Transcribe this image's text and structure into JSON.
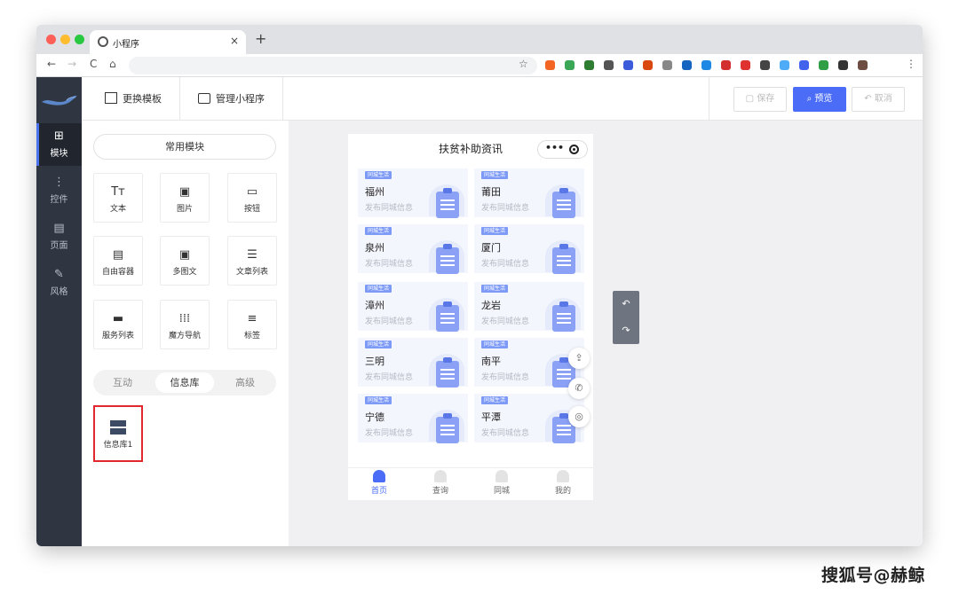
{
  "browser": {
    "tab_title": "小程序",
    "tab_close": "×",
    "new_tab": "+",
    "nav": {
      "back": "←",
      "forward": "→",
      "reload": "C",
      "home": "⌂"
    },
    "star": "☆",
    "menu": "⋮",
    "extensions": [
      "#f26522",
      "#3aa757",
      "#2e7d32",
      "#555555",
      "#3b5bdb",
      "#d9480f",
      "#888888",
      "#1565c0",
      "#1e88e5",
      "#d32f2f",
      "#e03131",
      "#444444",
      "#4dabf7",
      "#4263eb",
      "#2f9e44",
      "#333333",
      "#6d4c41"
    ]
  },
  "leftnav": {
    "items": [
      {
        "label": "模块",
        "icon": "plus-square-icon",
        "glyph": "⊞"
      },
      {
        "label": "控件",
        "icon": "controls-icon",
        "glyph": "⋮"
      },
      {
        "label": "页面",
        "icon": "page-icon",
        "glyph": "▤"
      },
      {
        "label": "风格",
        "icon": "magic-wand-icon",
        "glyph": "✎"
      }
    ]
  },
  "topbar": {
    "change_template": "更换模板",
    "manage_miniprogram": "管理小程序",
    "save": "保存",
    "preview": "预览",
    "cancel": "取消"
  },
  "panel": {
    "common_modules": "常用模块",
    "tiles": [
      {
        "label": "文本",
        "glyph": "Tт",
        "icon": "text-icon"
      },
      {
        "label": "图片",
        "glyph": "▣",
        "icon": "image-icon"
      },
      {
        "label": "按钮",
        "glyph": "▭",
        "icon": "button-icon"
      },
      {
        "label": "自由容器",
        "glyph": "▤",
        "icon": "container-icon"
      },
      {
        "label": "多图文",
        "glyph": "▣",
        "icon": "multi-article-icon"
      },
      {
        "label": "文章列表",
        "glyph": "☰",
        "icon": "article-list-icon"
      },
      {
        "label": "服务列表",
        "glyph": "▬",
        "icon": "service-list-icon"
      },
      {
        "label": "魔方导航",
        "glyph": "⁞⁞⁞",
        "icon": "grid-nav-icon"
      },
      {
        "label": "标签",
        "glyph": "≡",
        "icon": "tag-icon"
      }
    ],
    "segments": [
      "互动",
      "信息库",
      "高级"
    ],
    "selected_segment": "信息库",
    "info_tile": {
      "label": "信息库1",
      "glyph": "▦"
    }
  },
  "phone": {
    "title": "扶贫补助资讯",
    "capsule_more": "•••",
    "cards": [
      {
        "badge": "同城生活",
        "city": "福州",
        "sub": "发布同城信息"
      },
      {
        "badge": "同城生活",
        "city": "莆田",
        "sub": "发布同城信息"
      },
      {
        "badge": "同城生活",
        "city": "泉州",
        "sub": "发布同城信息"
      },
      {
        "badge": "同城生活",
        "city": "厦门",
        "sub": "发布同城信息"
      },
      {
        "badge": "同城生活",
        "city": "漳州",
        "sub": "发布同城信息"
      },
      {
        "badge": "同城生活",
        "city": "龙岩",
        "sub": "发布同城信息"
      },
      {
        "badge": "同城生活",
        "city": "三明",
        "sub": "发布同城信息"
      },
      {
        "badge": "同城生活",
        "city": "南平",
        "sub": "发布同城信息"
      },
      {
        "badge": "同城生活",
        "city": "宁德",
        "sub": "发布同城信息"
      },
      {
        "badge": "同城生活",
        "city": "平潭",
        "sub": "发布同城信息"
      }
    ],
    "float_buttons": [
      {
        "name": "share-icon",
        "glyph": "⇪"
      },
      {
        "name": "phone-icon",
        "glyph": "✆"
      },
      {
        "name": "wechat-icon",
        "glyph": "◎"
      }
    ],
    "tabbar": [
      {
        "label": "首页",
        "active": true
      },
      {
        "label": "查询",
        "active": false
      },
      {
        "label": "同城",
        "active": false
      },
      {
        "label": "我的",
        "active": false
      }
    ]
  },
  "history": {
    "undo": "↶",
    "redo": "↷"
  },
  "watermark": "搜狐号@赫鲸"
}
